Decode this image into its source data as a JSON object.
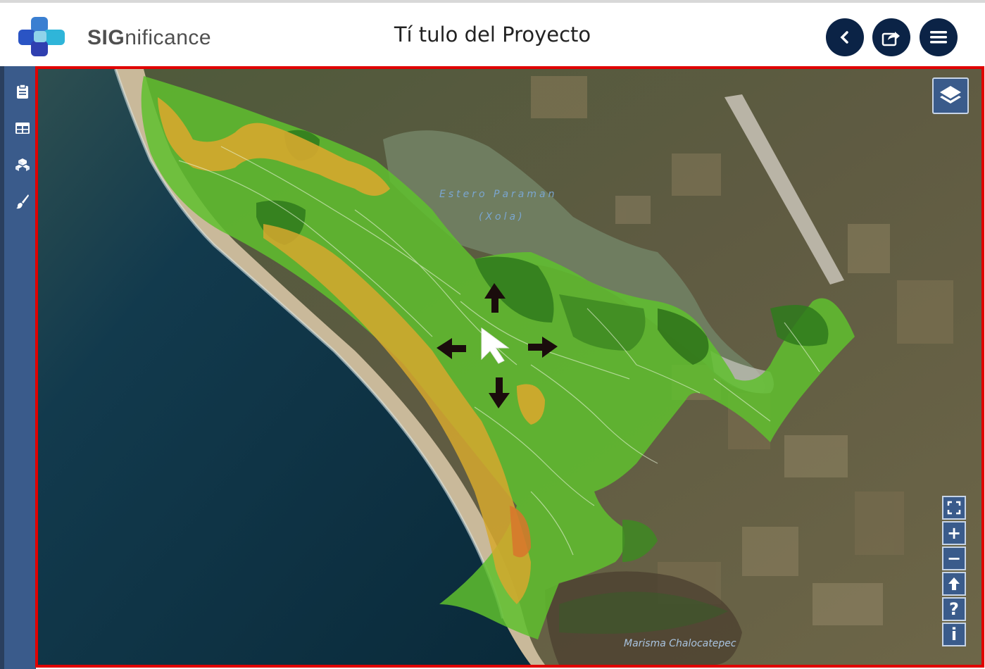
{
  "app": {
    "logo_prefix": "SIG",
    "logo_suffix": "nificance",
    "title": "Tí tulo del Proyecto"
  },
  "header_buttons": [
    {
      "icon": "chevron-left-icon"
    },
    {
      "icon": "share-icon"
    },
    {
      "icon": "hamburger-menu-icon"
    }
  ],
  "sidebar": {
    "items": [
      {
        "icon": "clipboard-icon"
      },
      {
        "icon": "table-icon"
      },
      {
        "icon": "cubes-icon"
      },
      {
        "icon": "paintbrush-icon"
      }
    ]
  },
  "map": {
    "labels": {
      "estero_line1": "Estero Paraman",
      "estero_line2": "(Xola)",
      "marisma": "Marisma Chalocatepec"
    },
    "controls": [
      {
        "name": "fullscreen-button",
        "symbol": "⛶"
      },
      {
        "name": "zoom-in-button",
        "symbol": "+"
      },
      {
        "name": "zoom-out-button",
        "symbol": "−"
      },
      {
        "name": "home-extent-button",
        "symbol": "🡑"
      },
      {
        "name": "help-button",
        "symbol": "?"
      },
      {
        "name": "info-button",
        "symbol": "i"
      }
    ]
  },
  "colors": {
    "header_button": "#0b2346",
    "sidebar": "#3a5b8b",
    "map_border": "#e00000",
    "ocean": "#0e3244",
    "land": "#5c5a3e",
    "lagoon": "#6f7d60",
    "zone_green": "#5fbf2e",
    "zone_dark_green": "#2f7a1c",
    "zone_yellow": "#d6a82e"
  }
}
